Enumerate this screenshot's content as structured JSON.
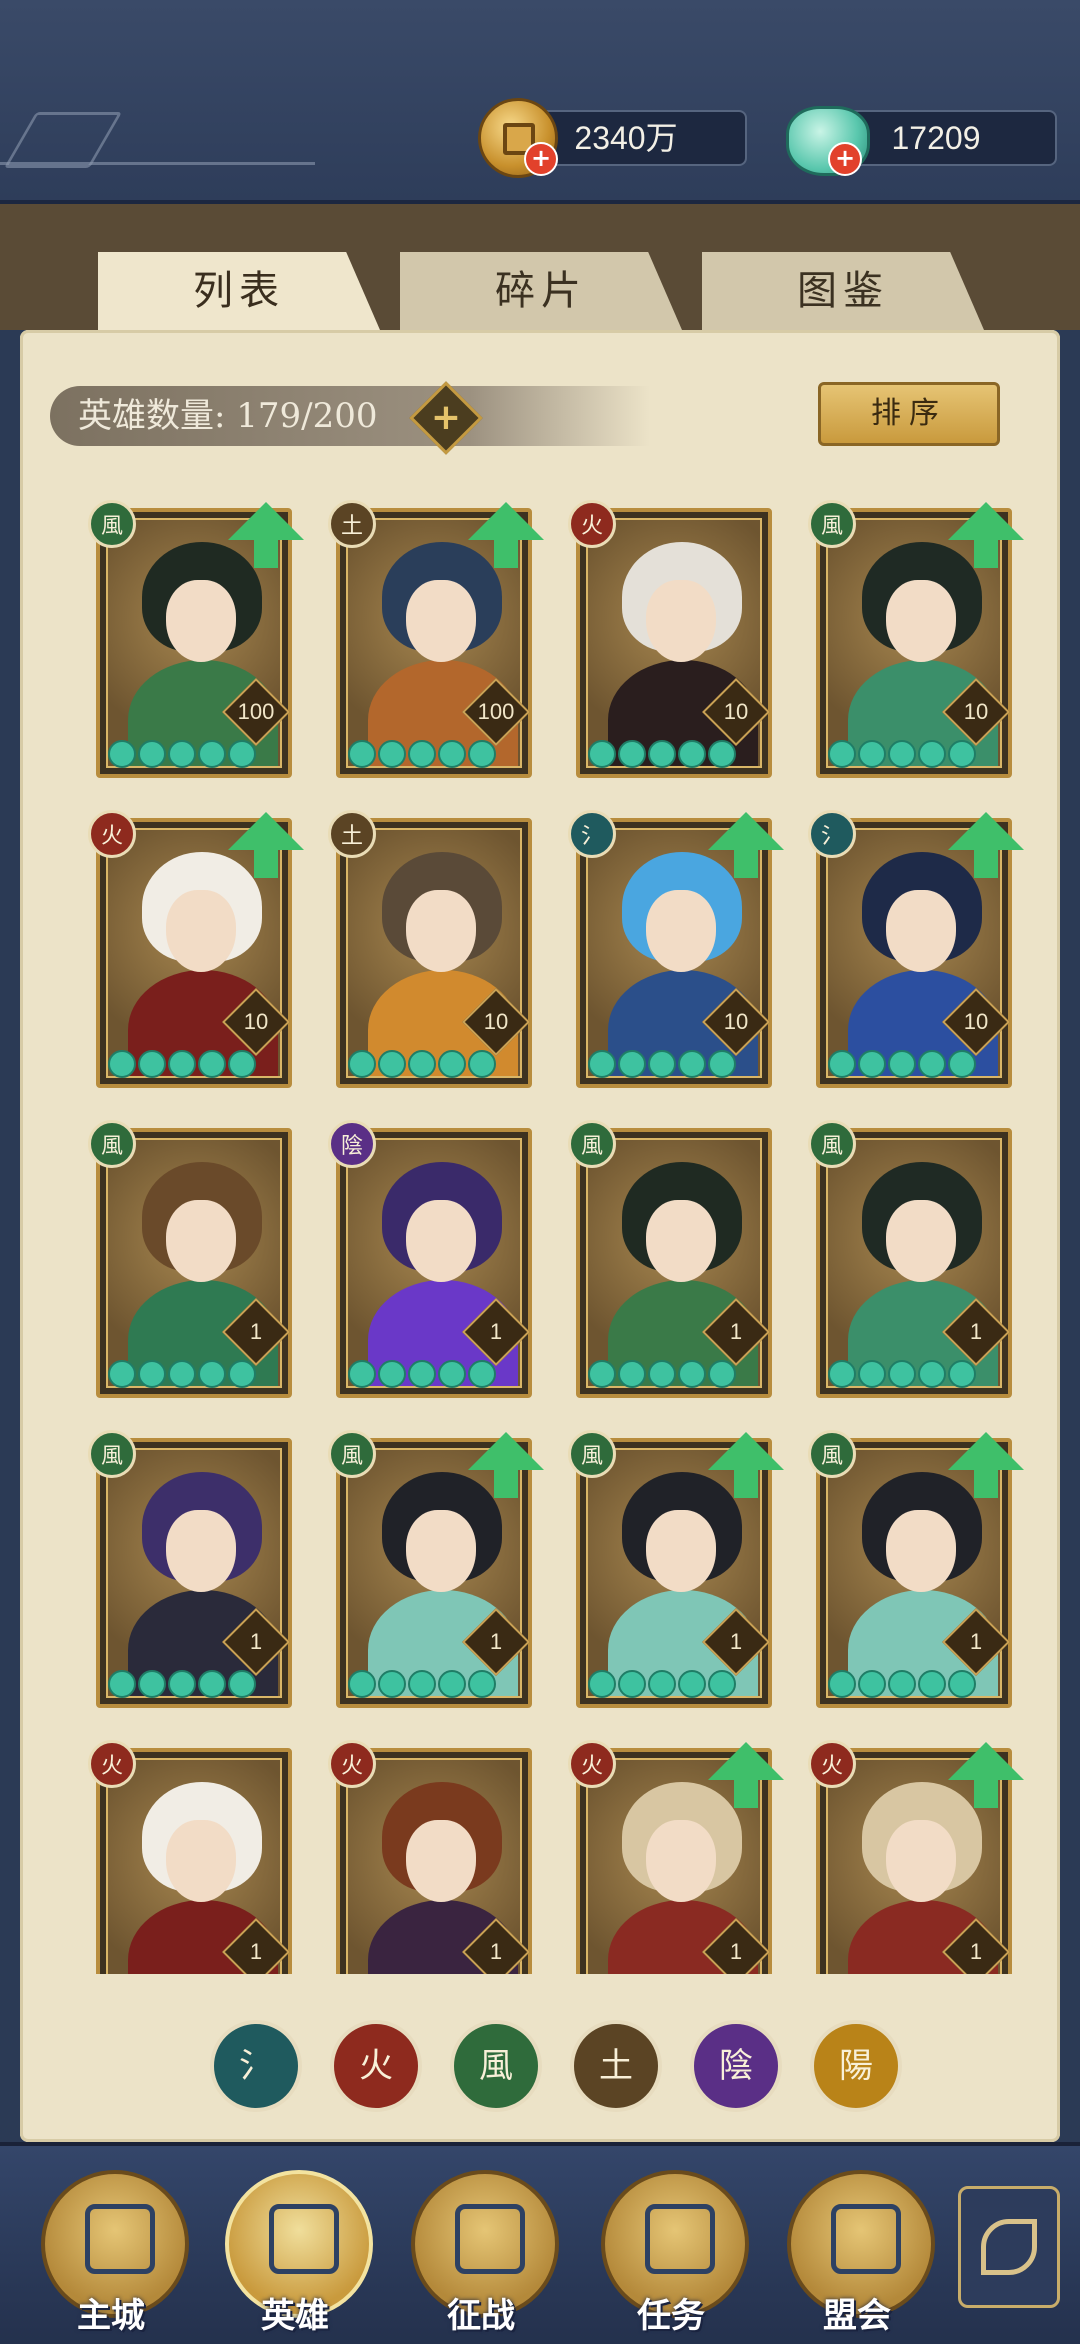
{
  "currency": {
    "gold_value": "2340万",
    "jade_value": "17209",
    "gold_icon": "copper-coin-icon",
    "jade_icon": "jade-pouch-icon"
  },
  "tabs": [
    {
      "label": "列表",
      "active": true
    },
    {
      "label": "碎片",
      "active": false
    },
    {
      "label": "图鉴",
      "active": false
    }
  ],
  "hero_count": {
    "label": "英雄数量: 179/200"
  },
  "sort_button": {
    "label": "排序"
  },
  "elements": {
    "water": {
      "glyph": "氵",
      "color": "#1f5a5e"
    },
    "fire": {
      "glyph": "火",
      "color": "#8e2a1e"
    },
    "wind": {
      "glyph": "風",
      "color": "#2f6b3b"
    },
    "earth": {
      "glyph": "土",
      "color": "#5b4424"
    },
    "yin": {
      "glyph": "陰",
      "color": "#5a2f86"
    },
    "yang": {
      "glyph": "陽",
      "color": "#b98318"
    }
  },
  "heroes": [
    {
      "element": "wind",
      "level": "100",
      "upgradable": true,
      "hair": "#1f2a22",
      "robe": "#3a7a48",
      "stars": 5
    },
    {
      "element": "earth",
      "level": "100",
      "upgradable": true,
      "hair": "#2a3e5a",
      "robe": "#b3672c",
      "stars": 5
    },
    {
      "element": "fire",
      "level": "10",
      "upgradable": false,
      "hair": "#e4e0d8",
      "robe": "#2a1e1e",
      "stars": 5
    },
    {
      "element": "wind",
      "level": "10",
      "upgradable": true,
      "hair": "#1f2a24",
      "robe": "#3b8f6a",
      "stars": 5
    },
    {
      "element": "fire",
      "level": "10",
      "upgradable": true,
      "hair": "#f1ede5",
      "robe": "#7a1f1c",
      "stars": 5
    },
    {
      "element": "earth",
      "level": "10",
      "upgradable": false,
      "hair": "#5a4a38",
      "robe": "#d18a2e",
      "stars": 5
    },
    {
      "element": "water",
      "level": "10",
      "upgradable": true,
      "hair": "#4aa6e0",
      "robe": "#2b4f8a",
      "stars": 5
    },
    {
      "element": "water",
      "level": "10",
      "upgradable": true,
      "hair": "#1e2a48",
      "robe": "#2c4fa0",
      "stars": 5
    },
    {
      "element": "wind",
      "level": "1",
      "upgradable": false,
      "hair": "#6a4a2a",
      "robe": "#2f7a52",
      "stars": 5
    },
    {
      "element": "yin",
      "level": "1",
      "upgradable": false,
      "hair": "#3a2a6a",
      "robe": "#6a38c8",
      "stars": 5
    },
    {
      "element": "wind",
      "level": "1",
      "upgradable": false,
      "hair": "#1f2a22",
      "robe": "#3a7a48",
      "stars": 5
    },
    {
      "element": "wind",
      "level": "1",
      "upgradable": false,
      "hair": "#1f2a24",
      "robe": "#3b8f6a",
      "stars": 5
    },
    {
      "element": "wind",
      "level": "1",
      "upgradable": false,
      "hair": "#3d2f6a",
      "robe": "#2a2a3a",
      "stars": 5
    },
    {
      "element": "wind",
      "level": "1",
      "upgradable": true,
      "hair": "#202228",
      "robe": "#7fc6b6",
      "stars": 5
    },
    {
      "element": "wind",
      "level": "1",
      "upgradable": true,
      "hair": "#202228",
      "robe": "#7fc6b6",
      "stars": 5
    },
    {
      "element": "wind",
      "level": "1",
      "upgradable": true,
      "hair": "#202228",
      "robe": "#7fc6b6",
      "stars": 5
    },
    {
      "element": "fire",
      "level": "1",
      "upgradable": false,
      "hair": "#f1ede5",
      "robe": "#7a1f1c",
      "stars": 5
    },
    {
      "element": "fire",
      "level": "1",
      "upgradable": false,
      "hair": "#7a3a1e",
      "robe": "#3a2440",
      "stars": 5
    },
    {
      "element": "fire",
      "level": "1",
      "upgradable": true,
      "hair": "#d8c6a2",
      "robe": "#8a2a22",
      "stars": 5
    },
    {
      "element": "fire",
      "level": "1",
      "upgradable": true,
      "hair": "#d8c6a2",
      "robe": "#8a2a22",
      "stars": 5
    }
  ],
  "filters": [
    "water",
    "fire",
    "wind",
    "earth",
    "yin",
    "yang"
  ],
  "nav": [
    {
      "label": "主城",
      "icon": "main-city-icon",
      "active": false
    },
    {
      "label": "英雄",
      "icon": "hero-icon",
      "active": true
    },
    {
      "label": "征战",
      "icon": "campaign-icon",
      "active": false
    },
    {
      "label": "任务",
      "icon": "quest-icon",
      "active": false
    },
    {
      "label": "盟会",
      "icon": "alliance-icon",
      "active": false
    }
  ],
  "menu_icon": "more-menu-icon"
}
